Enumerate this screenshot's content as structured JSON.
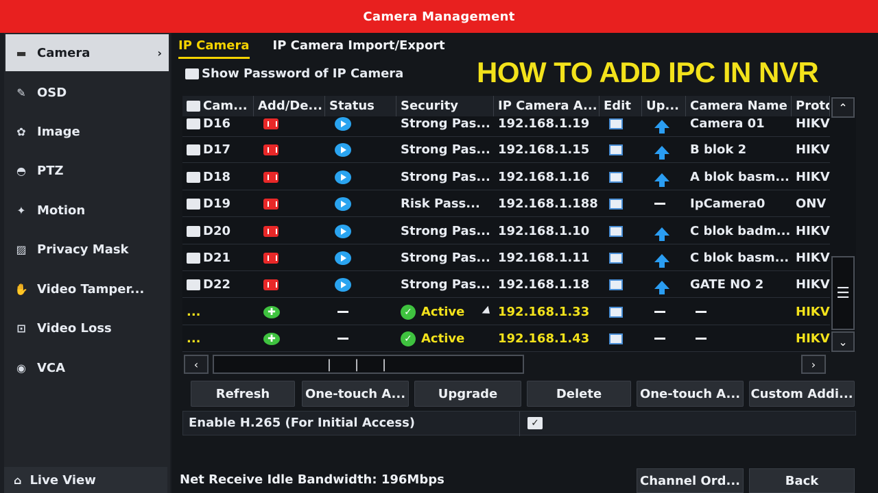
{
  "window": {
    "title": "Camera Management"
  },
  "overlay_text": "HOW TO ADD IPC IN NVR",
  "sidebar": {
    "items": [
      {
        "label": "Camera",
        "icon": "camera-icon",
        "active": true
      },
      {
        "label": "OSD",
        "icon": "osd-icon"
      },
      {
        "label": "Image",
        "icon": "image-icon"
      },
      {
        "label": "PTZ",
        "icon": "ptz-icon"
      },
      {
        "label": "Motion",
        "icon": "motion-icon"
      },
      {
        "label": "Privacy Mask",
        "icon": "privacy-mask-icon"
      },
      {
        "label": "Video Tamper...",
        "icon": "video-tamper-icon"
      },
      {
        "label": "Video Loss",
        "icon": "video-loss-icon"
      },
      {
        "label": "VCA",
        "icon": "vca-icon"
      }
    ],
    "live_view": "Live View"
  },
  "tabs": [
    "IP Camera",
    "IP Camera Import/Export"
  ],
  "show_password_label": "Show Password of IP Camera",
  "table": {
    "headers": [
      "Cam...",
      "Add/De...",
      "Status",
      "Security",
      "IP Camera A...",
      "Edit",
      "Up...",
      "Camera Name",
      "Proto"
    ],
    "rows": [
      {
        "cam": "D16",
        "action": "delete",
        "status": "play",
        "security": "Strong Pas...",
        "ip": "192.168.1.19",
        "upgrade": "up",
        "name": "Camera 01",
        "protocol": "HIKV"
      },
      {
        "cam": "D17",
        "action": "delete",
        "status": "play",
        "security": "Strong Pas...",
        "ip": "192.168.1.15",
        "upgrade": "up",
        "name": "B blok 2",
        "protocol": "HIKV"
      },
      {
        "cam": "D18",
        "action": "delete",
        "status": "play",
        "security": "Strong Pas...",
        "ip": "192.168.1.16",
        "upgrade": "up",
        "name": "A blok basm...",
        "protocol": "HIKV"
      },
      {
        "cam": "D19",
        "action": "delete",
        "status": "play",
        "security": "Risk Pass...",
        "ip": "192.168.1.188",
        "upgrade": "none",
        "name": "IpCamera0",
        "protocol": "ONV"
      },
      {
        "cam": "D20",
        "action": "delete",
        "status": "play",
        "security": "Strong Pas...",
        "ip": "192.168.1.10",
        "upgrade": "up",
        "name": "C blok badm...",
        "protocol": "HIKV"
      },
      {
        "cam": "D21",
        "action": "delete",
        "status": "play",
        "security": "Strong Pas...",
        "ip": "192.168.1.11",
        "upgrade": "up",
        "name": "C blok basm...",
        "protocol": "HIKV"
      },
      {
        "cam": "D22",
        "action": "delete",
        "status": "play",
        "security": "Strong Pas...",
        "ip": "192.168.1.18",
        "upgrade": "up",
        "name": "GATE NO 2",
        "protocol": "HIKV"
      },
      {
        "cam": "...",
        "action": "add",
        "status": "none",
        "security": "Active",
        "ip": "192.168.1.33",
        "upgrade": "none",
        "name": "—",
        "protocol": "HIKV"
      },
      {
        "cam": "...",
        "action": "add",
        "status": "none",
        "security": "Active",
        "ip": "192.168.1.43",
        "upgrade": "none",
        "name": "—",
        "protocol": "HIKV"
      }
    ]
  },
  "buttons": [
    "Refresh",
    "One-touch A...",
    "Upgrade",
    "Delete",
    "One-touch A...",
    "Custom Addi..."
  ],
  "h265_label": "Enable H.265 (For Initial Access)",
  "bandwidth": "Net Receive Idle Bandwidth: 196Mbps",
  "bottom_buttons": [
    "Channel Ord...",
    "Back"
  ],
  "colors": {
    "titlebar": "#e8201f",
    "accent": "#f5d300",
    "add": "#3fc23f",
    "delete": "#e82828",
    "status": "#2aa4f0"
  }
}
